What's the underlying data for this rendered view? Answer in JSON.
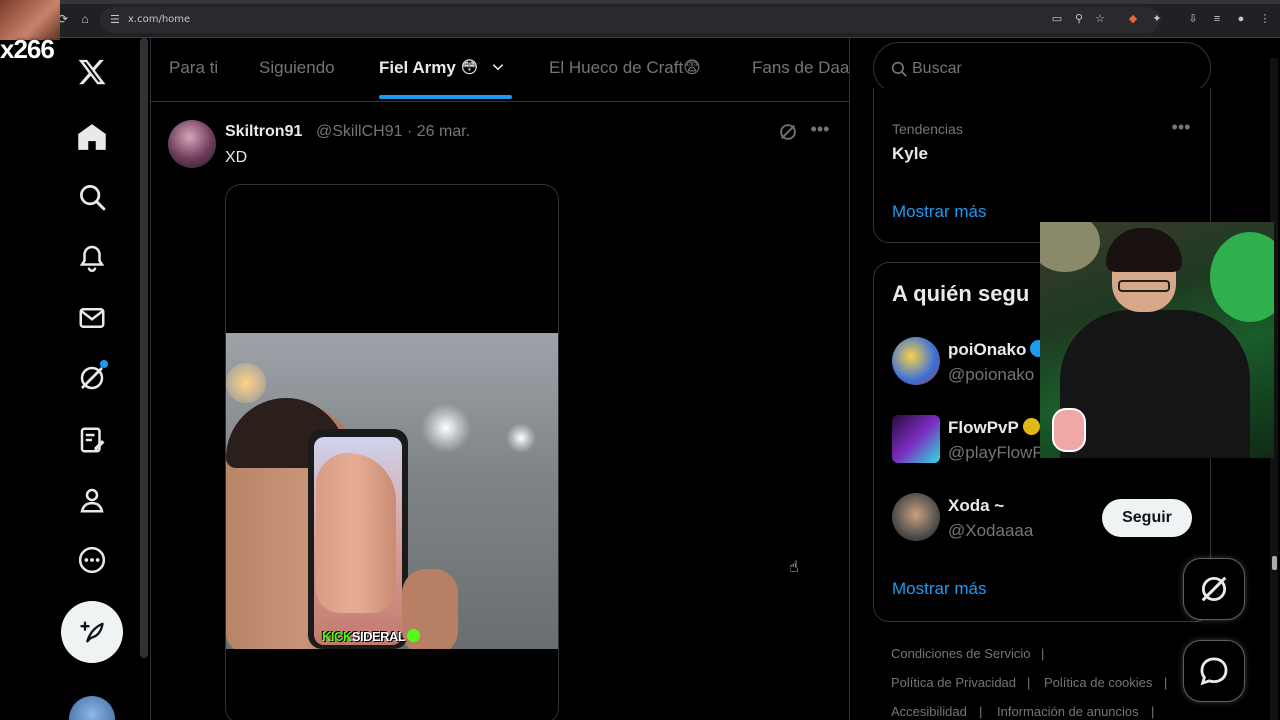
{
  "browser": {
    "url": "x.com/home"
  },
  "overlay": {
    "label": "x266"
  },
  "sidebar": {
    "items": [
      "x-logo",
      "home",
      "search",
      "notifications",
      "messages",
      "grok",
      "lists",
      "profile",
      "more"
    ]
  },
  "tabs": [
    {
      "label": "Para ti",
      "active": false
    },
    {
      "label": "Siguiendo",
      "active": false
    },
    {
      "label": "Fiel Army 😳",
      "active": true
    },
    {
      "label": "El Hueco de Craft😨",
      "active": false
    },
    {
      "label": "Fans de Daa",
      "active": false
    }
  ],
  "tweet": {
    "name": "Skiltron91",
    "handle_date": "@SkillCH91 · 26 mar.",
    "text": "XD",
    "media_watermark_a": "KICK",
    "media_watermark_b": "SIDERAL"
  },
  "search": {
    "placeholder": "Buscar"
  },
  "trends": {
    "meta": "Tendencias",
    "title": "Kyle",
    "show_more": "Mostrar más"
  },
  "who_to_follow": {
    "title": "A quién segu",
    "users": [
      {
        "name": "poiOnako",
        "handle": "@poionako",
        "verified": "blue"
      },
      {
        "name": "FlowPvP",
        "handle": "@playFlowPv",
        "verified": "gold"
      },
      {
        "name": "Xoda ~",
        "handle": "@Xodaaaa",
        "verified": "none",
        "button": "Seguir"
      }
    ],
    "show_more": "Mostrar más"
  },
  "footer": {
    "links": [
      "Condiciones de Servicio",
      "Política de Privacidad",
      "Política de cookies",
      "Accesibilidad",
      "Información de anuncios"
    ]
  },
  "colors": {
    "accent": "#1d9bf0",
    "background": "#000000",
    "muted_text": "#71767b"
  }
}
